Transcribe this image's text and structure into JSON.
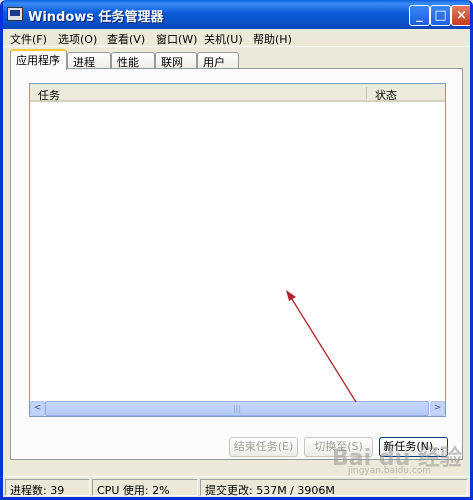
{
  "window": {
    "title": "Windows 任务管理器"
  },
  "title_buttons": {
    "minimize": "_",
    "maximize": "□",
    "close": "×"
  },
  "menu": [
    "文件(F)",
    "选项(O)",
    "查看(V)",
    "窗口(W)",
    "关机(U)",
    "帮助(H)"
  ],
  "tabs": [
    "应用程序",
    "进程",
    "性能",
    "联网",
    "用户"
  ],
  "active_tab": "应用程序",
  "list": {
    "columns": [
      "任务",
      "状态"
    ],
    "rows": []
  },
  "scrollbar": {
    "left_arrow": "<",
    "right_arrow": ">",
    "grip": "|||"
  },
  "buttons": {
    "end_task": "结束任务(E)",
    "switch_to": "切换至(S)",
    "new_task": "新任务(N)..."
  },
  "status": {
    "processes": "进程数: 39",
    "cpu": "CPU 使用: 2%",
    "commit": "提交更改: 537M / 3906M"
  },
  "watermark": {
    "text": "Bai du 经验",
    "sub": "jingyan.baidu.com"
  },
  "colors": {
    "title_bar": "#0A4FC8",
    "window_bg": "#ECE9D8",
    "arrow": "#B0232A"
  }
}
